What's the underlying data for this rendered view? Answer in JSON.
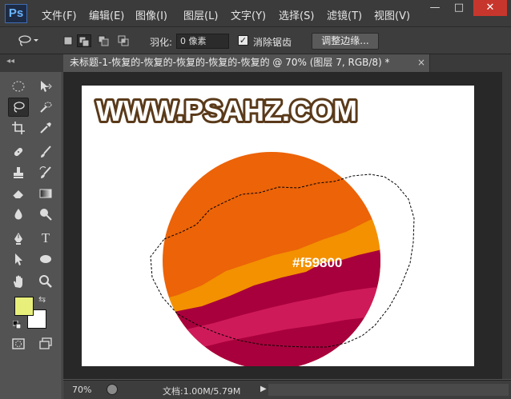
{
  "app": {
    "logo": "Ps",
    "menu": [
      "文件(F)",
      "编辑(E)",
      "图像(I)",
      "图层(L)",
      "文字(Y)",
      "选择(S)",
      "滤镜(T)",
      "视图(V)"
    ],
    "window_buttons": {
      "minimize": "—",
      "restore": "□",
      "close": "✕"
    }
  },
  "options": {
    "feather_label": "羽化:",
    "feather_value": "0 像素",
    "antialias_label": "消除锯齿",
    "antialias_checked": "✓",
    "refine_edge_label": "调整边缘..."
  },
  "document": {
    "tab_title": "未标题-1-恢复的-恢复的-恢复的-恢复的-恢复的 @ 70% (图层 7, RGB/8) *",
    "tab_close": "×",
    "watermark": "WWW.PSAHZ.COM",
    "color_label": "#f59800",
    "colors": {
      "orange_main": "#ec6308",
      "orange_light": "#f39100",
      "crimson": "#a8003c",
      "pink": "#cf1a5a",
      "watermark_text": "#ffffff",
      "watermark_outline": "#5a3a1a"
    }
  },
  "toolbar": {
    "panel_collapse": "◂◂",
    "foreground_color": "#e8f07b",
    "background_color": "#ffffff",
    "swap_icon": "⇆",
    "type_tool": "T"
  },
  "status": {
    "zoom": "70%",
    "doc_info": "文档:1.00M/5.79M",
    "arrow": "▶"
  }
}
